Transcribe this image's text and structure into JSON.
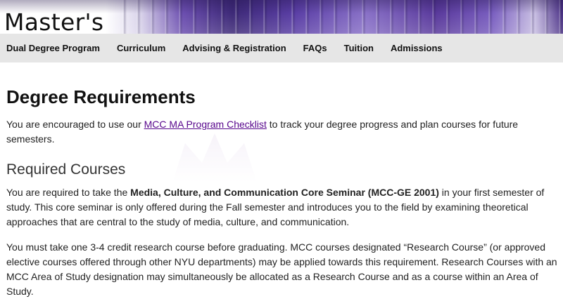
{
  "brand": {
    "title": "Master's"
  },
  "nav": {
    "items": [
      {
        "label": "Dual Degree Program"
      },
      {
        "label": "Curriculum"
      },
      {
        "label": "Advising & Registration"
      },
      {
        "label": "FAQs"
      },
      {
        "label": "Tuition"
      },
      {
        "label": "Admissions"
      }
    ]
  },
  "main": {
    "heading": "Degree Requirements",
    "intro": {
      "before": "You are encouraged to use our ",
      "link": "MCC MA Program Checklist",
      "after": " to track your degree progress and plan courses for future semesters."
    },
    "subheading": "Required Courses",
    "core": {
      "before": "You are required to take the ",
      "bold": "Media, Culture, and Communication Core Seminar (MCC-GE 2001)",
      "after": " in your first semester of study. This core seminar is only offered during the Fall semester and introduces you to the field by examining theoretical approaches that are central to the study of media, culture, and communication."
    },
    "research": "You must take one 3-4 credit research course before graduating. MCC courses designated “Research Course” (or approved elective courses offered through other NYU departments) may be applied towards this requirement. Research Courses with an MCC Area of Study designation may simultaneously be allocated as a Research Course and as a course within an Area of Study."
  },
  "colors": {
    "link": "#57068c",
    "nav_bg": "#e6e6e6",
    "banner_accent": "#57068c"
  }
}
